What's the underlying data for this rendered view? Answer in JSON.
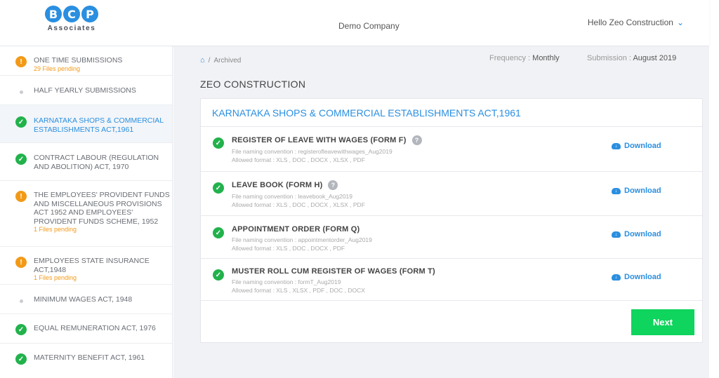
{
  "header": {
    "logo_letters": [
      "B",
      "C",
      "P"
    ],
    "logo_sub": "Associates",
    "company": "Demo Company",
    "greeting": "Hello Zeo Construction"
  },
  "sidebar": {
    "items": [
      {
        "label": "ONE TIME SUBMISSIONS",
        "pending": "29 Files pending",
        "status": "warning"
      },
      {
        "label": "HALF YEARLY SUBMISSIONS",
        "pending": "",
        "status": "none"
      },
      {
        "label": "KARNATAKA SHOPS & COMMERCIAL ESTABLISHMENTS ACT,1961",
        "pending": "",
        "status": "done",
        "active": true
      },
      {
        "label": "CONTRACT LABOUR (REGULATION AND ABOLITION) ACT, 1970",
        "pending": "",
        "status": "done"
      },
      {
        "label": "THE EMPLOYEES' PROVIDENT FUNDS AND MISCELLANEOUS PROVISIONS ACT 1952 AND EMPLOYEES' PROVIDENT FUNDS SCHEME, 1952",
        "pending": "1 Files pending",
        "status": "warning"
      },
      {
        "label": "EMPLOYEES STATE INSURANCE ACT,1948",
        "pending": "1 Files pending",
        "status": "warning"
      },
      {
        "label": "MINIMUM WAGES ACT, 1948",
        "pending": "",
        "status": "none"
      },
      {
        "label": "EQUAL REMUNERATION ACT, 1976",
        "pending": "",
        "status": "done"
      },
      {
        "label": "MATERNITY BENEFIT ACT, 1961",
        "pending": "",
        "status": "done"
      }
    ]
  },
  "main": {
    "breadcrumb": "Archived",
    "frequency_label": "Frequency :",
    "frequency_value": "Monthly",
    "submission_label": "Submission :",
    "submission_value": "August 2019",
    "company_title": "ZEO CONSTRUCTION",
    "card_title": "KARNATAKA SHOPS & COMMERCIAL ESTABLISHMENTS ACT,1961",
    "download_label": "Download",
    "next_label": "Next",
    "forms": [
      {
        "name": "REGISTER OF LEAVE WITH WAGES (FORM F)",
        "help": true,
        "naming": "File naming convention : registerofleavewithwages_Aug2019",
        "formats": "Allowed format : XLS , DOC , DOCX , XLSX , PDF"
      },
      {
        "name": "LEAVE BOOK (FORM H)",
        "help": true,
        "naming": "File naming convention : leavebook_Aug2019",
        "formats": "Allowed format : XLS , DOC , DOCX , XLSX , PDF"
      },
      {
        "name": "APPOINTMENT ORDER (FORM Q)",
        "help": false,
        "naming": "File naming convention : appointmentorder_Aug2019",
        "formats": "Allowed format : XLS , DOC , DOCX , PDF"
      },
      {
        "name": "MUSTER ROLL CUM REGISTER OF WAGES (FORM T)",
        "help": false,
        "naming": "File naming convention : formT_Aug2019",
        "formats": "Allowed format : XLS , XLSX , PDF , DOC , DOCX"
      }
    ]
  }
}
